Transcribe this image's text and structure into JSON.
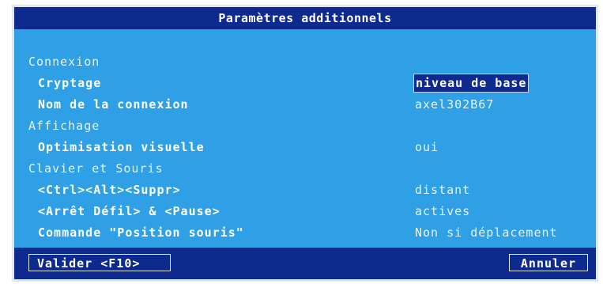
{
  "dialog": {
    "title": "Paramètres additionnels"
  },
  "sections": {
    "connexion": {
      "label": "Connexion",
      "items": [
        {
          "label": "Cryptage",
          "value": "niveau de base"
        },
        {
          "label": "Nom de la connexion",
          "value": "axel302B67"
        }
      ]
    },
    "affichage": {
      "label": "Affichage",
      "items": [
        {
          "label": "Optimisation visuelle",
          "value": "oui"
        }
      ]
    },
    "clavier": {
      "label": "Clavier et Souris",
      "items": [
        {
          "label": "<Ctrl><Alt><Suppr>",
          "value": "distant"
        },
        {
          "label": "<Arrêt Défil> & <Pause>",
          "value": "actives"
        },
        {
          "label": "Commande \"Position souris\"",
          "value": "Non si déplacement"
        }
      ]
    }
  },
  "footer": {
    "validate_label": "Valider <F10>",
    "cancel_label": "Annuler"
  },
  "colors": {
    "background": "#2f9fe6",
    "bar": "#0f2a8f",
    "text": "#ffffff"
  }
}
